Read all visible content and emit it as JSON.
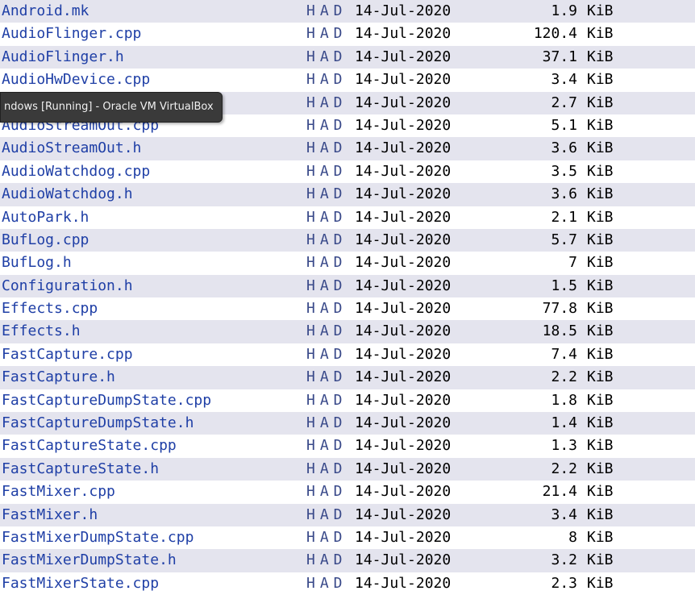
{
  "had_label": "HAD",
  "tooltip_text": "ndows [Running] - Oracle VM VirtualBox",
  "files": [
    {
      "name": "Android.mk",
      "date": "14-Jul-2020",
      "size": "1.9",
      "unit": "KiB"
    },
    {
      "name": "AudioFlinger.cpp",
      "date": "14-Jul-2020",
      "size": "120.4",
      "unit": "KiB"
    },
    {
      "name": "AudioFlinger.h",
      "date": "14-Jul-2020",
      "size": "37.1",
      "unit": "KiB"
    },
    {
      "name": "AudioHwDevice.cpp",
      "date": "14-Jul-2020",
      "size": "3.4",
      "unit": "KiB"
    },
    {
      "name": "",
      "date": "14-Jul-2020",
      "size": "2.7",
      "unit": "KiB"
    },
    {
      "name": "AudioStreamOut.cpp",
      "date": "14-Jul-2020",
      "size": "5.1",
      "unit": "KiB"
    },
    {
      "name": "AudioStreamOut.h",
      "date": "14-Jul-2020",
      "size": "3.6",
      "unit": "KiB"
    },
    {
      "name": "AudioWatchdog.cpp",
      "date": "14-Jul-2020",
      "size": "3.5",
      "unit": "KiB"
    },
    {
      "name": "AudioWatchdog.h",
      "date": "14-Jul-2020",
      "size": "3.6",
      "unit": "KiB"
    },
    {
      "name": "AutoPark.h",
      "date": "14-Jul-2020",
      "size": "2.1",
      "unit": "KiB"
    },
    {
      "name": "BufLog.cpp",
      "date": "14-Jul-2020",
      "size": "5.7",
      "unit": "KiB"
    },
    {
      "name": "BufLog.h",
      "date": "14-Jul-2020",
      "size": "7",
      "unit": "KiB"
    },
    {
      "name": "Configuration.h",
      "date": "14-Jul-2020",
      "size": "1.5",
      "unit": "KiB"
    },
    {
      "name": "Effects.cpp",
      "date": "14-Jul-2020",
      "size": "77.8",
      "unit": "KiB"
    },
    {
      "name": "Effects.h",
      "date": "14-Jul-2020",
      "size": "18.5",
      "unit": "KiB"
    },
    {
      "name": "FastCapture.cpp",
      "date": "14-Jul-2020",
      "size": "7.4",
      "unit": "KiB"
    },
    {
      "name": "FastCapture.h",
      "date": "14-Jul-2020",
      "size": "2.2",
      "unit": "KiB"
    },
    {
      "name": "FastCaptureDumpState.cpp",
      "date": "14-Jul-2020",
      "size": "1.8",
      "unit": "KiB"
    },
    {
      "name": "FastCaptureDumpState.h",
      "date": "14-Jul-2020",
      "size": "1.4",
      "unit": "KiB"
    },
    {
      "name": "FastCaptureState.cpp",
      "date": "14-Jul-2020",
      "size": "1.3",
      "unit": "KiB"
    },
    {
      "name": "FastCaptureState.h",
      "date": "14-Jul-2020",
      "size": "2.2",
      "unit": "KiB"
    },
    {
      "name": "FastMixer.cpp",
      "date": "14-Jul-2020",
      "size": "21.4",
      "unit": "KiB"
    },
    {
      "name": "FastMixer.h",
      "date": "14-Jul-2020",
      "size": "3.4",
      "unit": "KiB"
    },
    {
      "name": "FastMixerDumpState.cpp",
      "date": "14-Jul-2020",
      "size": "8",
      "unit": "KiB"
    },
    {
      "name": "FastMixerDumpState.h",
      "date": "14-Jul-2020",
      "size": "3.2",
      "unit": "KiB"
    },
    {
      "name": "FastMixerState.cpp",
      "date": "14-Jul-2020",
      "size": "2.3",
      "unit": "KiB"
    }
  ]
}
